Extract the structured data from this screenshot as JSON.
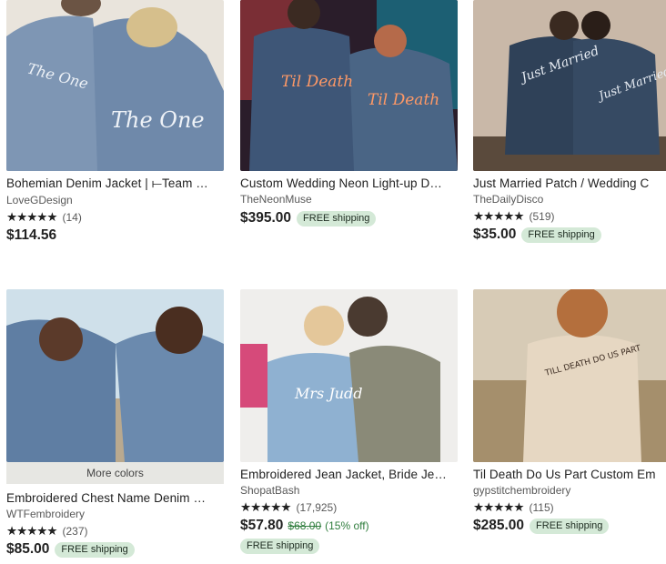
{
  "products": [
    {
      "title": "Bohemian Denim Jacket | ⟝Team …",
      "shop": "LoveGDesign",
      "stars": "★★★★★",
      "reviews": "(14)",
      "price": "$114.56",
      "shipping": "",
      "art": "The One"
    },
    {
      "title": "Custom Wedding Neon Light-up D…",
      "shop": "TheNeonMuse",
      "stars": "",
      "reviews": "",
      "price": "$395.00",
      "shipping": "FREE shipping",
      "art": "Til Death"
    },
    {
      "title": "Just Married Patch / Wedding C",
      "shop": "TheDailyDisco",
      "stars": "★★★★★",
      "reviews": "(519)",
      "price": "$35.00",
      "shipping": "FREE shipping",
      "art": "Just Married"
    },
    {
      "title": "Embroidered Chest Name Denim …",
      "shop": "WTFembroidery",
      "stars": "★★★★★",
      "reviews": "(237)",
      "price": "$85.00",
      "shipping": "FREE shipping",
      "colors_label": "More colors"
    },
    {
      "title": "Embroidered Jean Jacket, Bride Je…",
      "shop": "ShopatBash",
      "stars": "★★★★★",
      "reviews": "(17,925)",
      "price": "$57.80",
      "old_price": "$68.00",
      "discount": "(15% off)",
      "shipping": "FREE shipping",
      "art": "Mrs Judd"
    },
    {
      "title": "Til Death Do Us Part Custom Em",
      "shop": "gypstitchembroidery",
      "stars": "★★★★★",
      "reviews": "(115)",
      "price": "$285.00",
      "shipping": "FREE shipping",
      "art": "TILL DEATH DO US PART"
    }
  ],
  "colors": {
    "badge_bg": "#d4e9d7",
    "text": "#222222",
    "muted": "#595959",
    "discount": "#2f7d3d"
  }
}
